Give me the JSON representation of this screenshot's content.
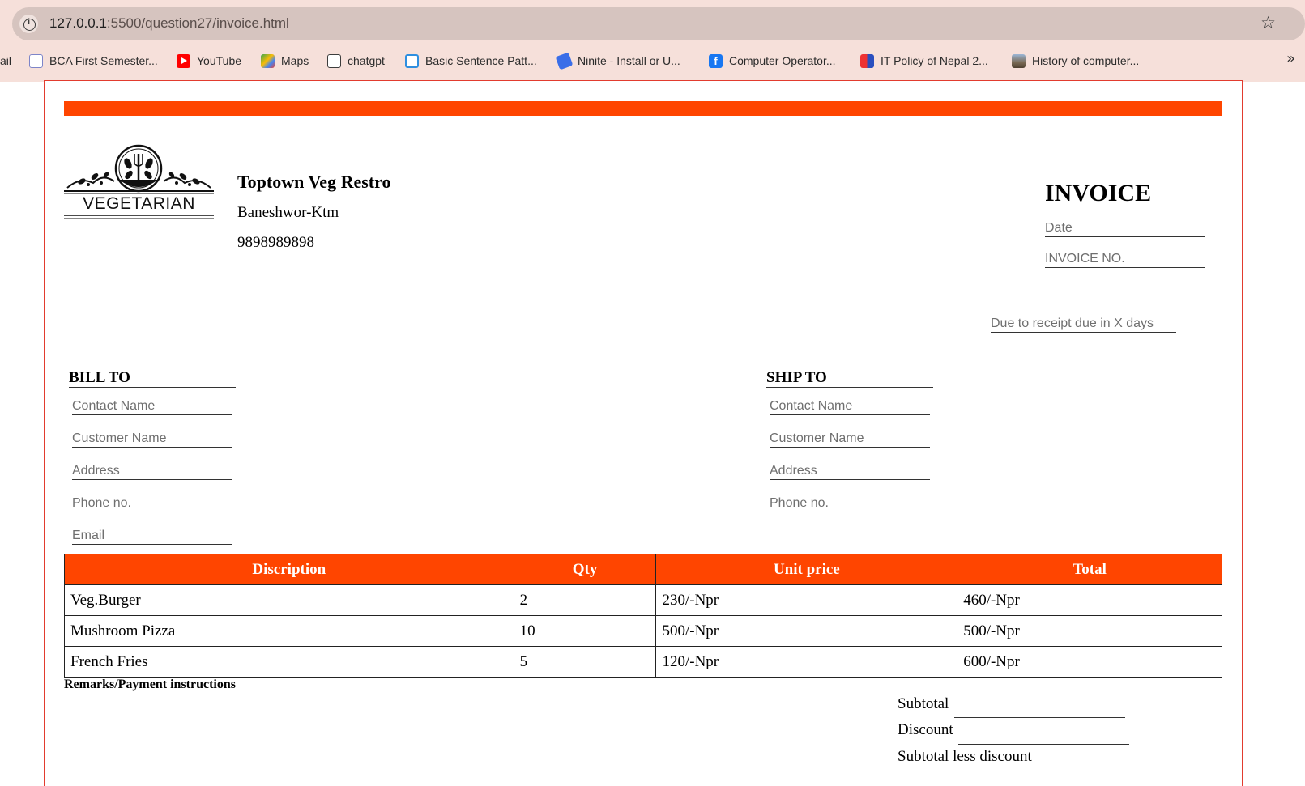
{
  "browser": {
    "url_host": "127.0.0.1",
    "url_path": ":5500/question27/invoice.html",
    "bookmarks": [
      {
        "label": "ail",
        "icon": "none"
      },
      {
        "label": "BCA First Semester...",
        "icon": "bca-icon"
      },
      {
        "label": "YouTube",
        "icon": "youtube-icon"
      },
      {
        "label": "Maps",
        "icon": "maps-icon"
      },
      {
        "label": "chatgpt",
        "icon": "chatgpt-icon"
      },
      {
        "label": "Basic Sentence Patt...",
        "icon": "quizlet-icon"
      },
      {
        "label": "Ninite - Install or U...",
        "icon": "ninite-icon"
      },
      {
        "label": "Computer Operator...",
        "icon": "facebook-icon"
      },
      {
        "label": "IT Policy of Nepal 2...",
        "icon": "itpolicy-icon"
      },
      {
        "label": "History of computer...",
        "icon": "history-icon"
      }
    ],
    "more_label": "»"
  },
  "invoice": {
    "logo_text": "VEGETARIAN",
    "company": {
      "name": "Toptown Veg Restro",
      "address": "Baneshwor-Ktm",
      "phone": "9898989898"
    },
    "title": "INVOICE",
    "date_label": "Date",
    "invoice_no_label": "INVOICE NO.",
    "due_text": "Due to receipt due in X days",
    "bill_to": {
      "title": "BILL TO",
      "fields": [
        "Contact Name",
        "Customer Name",
        "Address",
        "Phone no.",
        "Email"
      ]
    },
    "ship_to": {
      "title": "SHIP TO",
      "fields": [
        "Contact Name",
        "Customer Name",
        "Address",
        "Phone no."
      ]
    },
    "table": {
      "headers": [
        "Discription",
        "Qty",
        "Unit price",
        "Total"
      ],
      "rows": [
        [
          "Veg.Burger",
          "2",
          "230/-Npr",
          "460/-Npr"
        ],
        [
          "Mushroom Pizza",
          "10",
          "500/-Npr",
          "500/-Npr"
        ],
        [
          "French Fries",
          "5",
          "120/-Npr",
          "600/-Npr"
        ]
      ]
    },
    "remarks_label": "Remarks/Payment instructions",
    "summary": {
      "subtotal": "Subtotal",
      "discount": "Discount",
      "subtotal_less_discount": "Subtotal less discount"
    },
    "colors": {
      "accent": "#ff4500",
      "page_border": "#e23b2e"
    }
  }
}
